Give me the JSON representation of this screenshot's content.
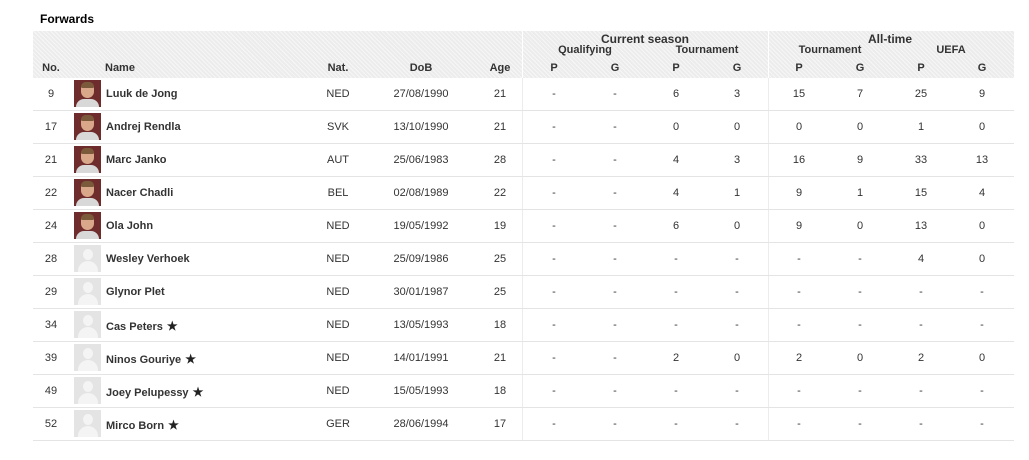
{
  "section_title": "Forwards",
  "header": {
    "current_season": "Current season",
    "all_time": "All-time",
    "qualifying": "Qualifying",
    "tournament": "Tournament",
    "tournament_alltime": "Tournament",
    "uefa": "UEFA",
    "no": "No.",
    "name": "Name",
    "nat": "Nat.",
    "dob": "DoB",
    "age": "Age",
    "p": "P",
    "g": "G"
  },
  "star_glyph": "★",
  "players": [
    {
      "no": "9",
      "name": "Luuk de Jong",
      "nat": "NED",
      "dob": "27/08/1990",
      "age": "21",
      "qp": "-",
      "qg": "-",
      "tp": "6",
      "tg": "3",
      "atp": "15",
      "atg": "7",
      "up": "25",
      "ug": "9",
      "photo": "player-photo",
      "star": false
    },
    {
      "no": "17",
      "name": "Andrej Rendla",
      "nat": "SVK",
      "dob": "13/10/1990",
      "age": "21",
      "qp": "-",
      "qg": "-",
      "tp": "0",
      "tg": "0",
      "atp": "0",
      "atg": "0",
      "up": "1",
      "ug": "0",
      "photo": "player-photo",
      "star": false
    },
    {
      "no": "21",
      "name": "Marc Janko",
      "nat": "AUT",
      "dob": "25/06/1983",
      "age": "28",
      "qp": "-",
      "qg": "-",
      "tp": "4",
      "tg": "3",
      "atp": "16",
      "atg": "9",
      "up": "33",
      "ug": "13",
      "photo": "player-photo",
      "star": false
    },
    {
      "no": "22",
      "name": "Nacer Chadli",
      "nat": "BEL",
      "dob": "02/08/1989",
      "age": "22",
      "qp": "-",
      "qg": "-",
      "tp": "4",
      "tg": "1",
      "atp": "9",
      "atg": "1",
      "up": "15",
      "ug": "4",
      "photo": "player-photo",
      "star": false
    },
    {
      "no": "24",
      "name": "Ola John",
      "nat": "NED",
      "dob": "19/05/1992",
      "age": "19",
      "qp": "-",
      "qg": "-",
      "tp": "6",
      "tg": "0",
      "atp": "9",
      "atg": "0",
      "up": "13",
      "ug": "0",
      "photo": "player-photo",
      "star": false
    },
    {
      "no": "28",
      "name": "Wesley Verhoek",
      "nat": "NED",
      "dob": "25/09/1986",
      "age": "25",
      "qp": "-",
      "qg": "-",
      "tp": "-",
      "tg": "-",
      "atp": "-",
      "atg": "-",
      "up": "4",
      "ug": "0",
      "photo": "placeholder-avatar",
      "star": false
    },
    {
      "no": "29",
      "name": "Glynor Plet",
      "nat": "NED",
      "dob": "30/01/1987",
      "age": "25",
      "qp": "-",
      "qg": "-",
      "tp": "-",
      "tg": "-",
      "atp": "-",
      "atg": "-",
      "up": "-",
      "ug": "-",
      "photo": "placeholder-avatar",
      "star": false
    },
    {
      "no": "34",
      "name": "Cas Peters",
      "nat": "NED",
      "dob": "13/05/1993",
      "age": "18",
      "qp": "-",
      "qg": "-",
      "tp": "-",
      "tg": "-",
      "atp": "-",
      "atg": "-",
      "up": "-",
      "ug": "-",
      "photo": "placeholder-avatar",
      "star": true
    },
    {
      "no": "39",
      "name": "Ninos Gouriye",
      "nat": "NED",
      "dob": "14/01/1991",
      "age": "21",
      "qp": "-",
      "qg": "-",
      "tp": "2",
      "tg": "0",
      "atp": "2",
      "atg": "0",
      "up": "2",
      "ug": "0",
      "photo": "placeholder-avatar",
      "star": true
    },
    {
      "no": "49",
      "name": "Joey Pelupessy",
      "nat": "NED",
      "dob": "15/05/1993",
      "age": "18",
      "qp": "-",
      "qg": "-",
      "tp": "-",
      "tg": "-",
      "atp": "-",
      "atg": "-",
      "up": "-",
      "ug": "-",
      "photo": "placeholder-avatar",
      "star": true
    },
    {
      "no": "52",
      "name": "Mirco Born",
      "nat": "GER",
      "dob": "28/06/1994",
      "age": "17",
      "qp": "-",
      "qg": "-",
      "tp": "-",
      "tg": "-",
      "atp": "-",
      "atg": "-",
      "up": "-",
      "ug": "-",
      "photo": "placeholder-avatar",
      "star": true
    }
  ]
}
